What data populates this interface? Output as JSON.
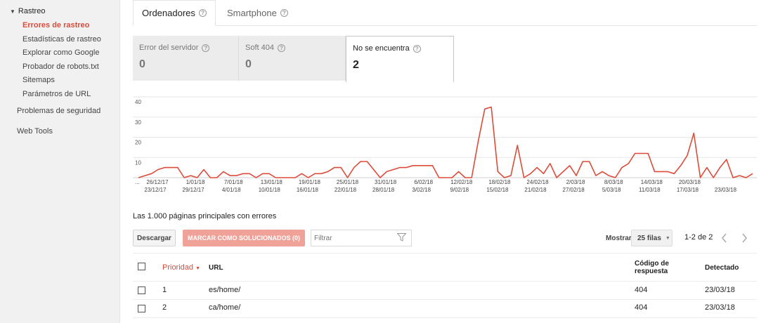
{
  "sidebar": {
    "section": "Rastreo",
    "items": [
      {
        "label": "Errores de rastreo",
        "active": true
      },
      {
        "label": "Estadísticas de rastreo"
      },
      {
        "label": "Explorar como Google"
      },
      {
        "label": "Probador de robots.txt"
      },
      {
        "label": "Sitemaps"
      },
      {
        "label": "Parámetros de URL"
      }
    ],
    "top_items": [
      {
        "label": "Problemas de seguridad"
      },
      {
        "label": "Web Tools"
      }
    ]
  },
  "tabs": [
    {
      "label": "Ordenadores",
      "active": true
    },
    {
      "label": "Smartphone"
    }
  ],
  "cards": [
    {
      "label": "Error del servidor",
      "value": "0"
    },
    {
      "label": "Soft 404",
      "value": "0"
    },
    {
      "label": "No se encuentra",
      "value": "2",
      "selected": true
    }
  ],
  "chart_data": {
    "type": "line",
    "color": "#dd4b39",
    "ylim": [
      0,
      40
    ],
    "yticks": [
      "40",
      "30",
      "20",
      "10"
    ],
    "xticks_top": [
      "26/12/17",
      "1/01/18",
      "7/01/18",
      "13/01/18",
      "19/01/18",
      "25/01/18",
      "31/01/18",
      "6/02/18",
      "12/02/18",
      "18/02/18",
      "24/02/18",
      "2/03/18",
      "8/03/18",
      "14/03/18",
      "20/03/18"
    ],
    "xticks_bottom": [
      "23/12/17",
      "29/12/17",
      "4/01/18",
      "10/01/18",
      "16/01/18",
      "22/01/18",
      "28/01/18",
      "3/02/18",
      "9/02/18",
      "15/02/18",
      "21/02/18",
      "27/02/18",
      "5/03/18",
      "11/03/18",
      "17/03/18",
      "23/03/18"
    ],
    "values": [
      0,
      1,
      2,
      4,
      5,
      5,
      5,
      0,
      1,
      0,
      4,
      0,
      0,
      3,
      1,
      1,
      2,
      2,
      0,
      2,
      2,
      0,
      0,
      0,
      0,
      2,
      0,
      2,
      2,
      3,
      5,
      5,
      0,
      5,
      8,
      8,
      4,
      0,
      3,
      4,
      5,
      5,
      6,
      6,
      6,
      6,
      0,
      0,
      0,
      3,
      0,
      0,
      18,
      34,
      35,
      3,
      0,
      1,
      16,
      0,
      2,
      5,
      2,
      7,
      0,
      3,
      6,
      1,
      8,
      8,
      1,
      3,
      1,
      0,
      5,
      7,
      12,
      12,
      12,
      3,
      3,
      3,
      2,
      6,
      11,
      22,
      0,
      5,
      0,
      5,
      9,
      0,
      1,
      0,
      2
    ],
    "last_label": "..."
  },
  "table": {
    "title": "Las 1.000 páginas principales con errores",
    "download": "Descargar",
    "mark": "MARCAR COMO SOLUCIONADOS (0)",
    "filter_placeholder": "Filtrar",
    "show_label": "Mostrar",
    "rows_select": "25 filas",
    "pager": "1-2 de 2",
    "headers": {
      "priority": "Prioridad",
      "url": "URL",
      "code_1": "Código de",
      "code_2": "respuesta",
      "detected": "Detectado"
    },
    "rows": [
      {
        "priority": "1",
        "url": "es/home/",
        "code": "404",
        "detected": "23/03/18"
      },
      {
        "priority": "2",
        "url": "ca/home/",
        "code": "404",
        "detected": "23/03/18"
      }
    ]
  }
}
